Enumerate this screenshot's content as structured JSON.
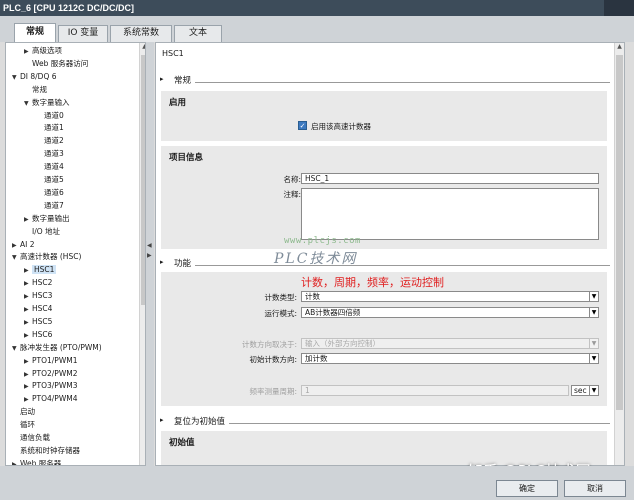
{
  "window": {
    "title": "PLC_6 [CPU 1212C DC/DC/DC]"
  },
  "tabs": [
    {
      "label": "常规",
      "active": true
    },
    {
      "label": "IO 变量",
      "active": false
    },
    {
      "label": "系统常数",
      "active": false
    },
    {
      "label": "文本",
      "active": false
    }
  ],
  "tree": {
    "items": [
      {
        "label": "高级选项",
        "expander": "right"
      },
      {
        "label": "Web 服务器访问",
        "expander": ""
      },
      {
        "label": "DI 8/DQ 6",
        "expander": "down"
      },
      {
        "label": "常规",
        "expander": ""
      },
      {
        "label": "数字量输入",
        "expander": "down"
      },
      {
        "label": "通道0",
        "expander": ""
      },
      {
        "label": "通道1",
        "expander": ""
      },
      {
        "label": "通道2",
        "expander": ""
      },
      {
        "label": "通道3",
        "expander": ""
      },
      {
        "label": "通道4",
        "expander": ""
      },
      {
        "label": "通道5",
        "expander": ""
      },
      {
        "label": "通道6",
        "expander": ""
      },
      {
        "label": "通道7",
        "expander": ""
      },
      {
        "label": "数字量输出",
        "expander": "right"
      },
      {
        "label": "I/O 地址",
        "expander": ""
      },
      {
        "label": "AI 2",
        "expander": "right"
      },
      {
        "label": "高速计数器 (HSC)",
        "expander": "down"
      },
      {
        "label": "HSC1",
        "expander": "right",
        "selected": true
      },
      {
        "label": "HSC2",
        "expander": "right"
      },
      {
        "label": "HSC3",
        "expander": "right"
      },
      {
        "label": "HSC4",
        "expander": "right"
      },
      {
        "label": "HSC5",
        "expander": "right"
      },
      {
        "label": "HSC6",
        "expander": "right"
      },
      {
        "label": "脉冲发生器 (PTO/PWM)",
        "expander": "down"
      },
      {
        "label": "PTO1/PWM1",
        "expander": "right"
      },
      {
        "label": "PTO2/PWM2",
        "expander": "right"
      },
      {
        "label": "PTO3/PWM3",
        "expander": "right"
      },
      {
        "label": "PTO4/PWM4",
        "expander": "right"
      },
      {
        "label": "启动",
        "expander": ""
      },
      {
        "label": "循环",
        "expander": ""
      },
      {
        "label": "通信负载",
        "expander": ""
      },
      {
        "label": "系统和时钟存储器",
        "expander": ""
      },
      {
        "label": "Web 服务器",
        "expander": "right"
      }
    ]
  },
  "main": {
    "header": "HSC1",
    "sections": {
      "general": "常规",
      "function": "功能",
      "reset": "复位为初始值"
    },
    "enable": {
      "title": "启用",
      "checkbox_label": "启用该高速计数器",
      "checked": true
    },
    "project_info": {
      "title": "项目信息",
      "name_label": "名称:",
      "name_value": "HSC_1",
      "comment_label": "注释:",
      "comment_value": ""
    },
    "function": {
      "count_type_label": "计数类型:",
      "count_type_value": "计数",
      "mode_label": "运行模式:",
      "mode_value": "AB计数器四倍频",
      "direction_source_label": "计数方向取决于:",
      "direction_source_value": "输入（外部方向控制）",
      "initial_direction_label": "初始计数方向:",
      "initial_direction_value": "加计数",
      "freq_period_label": "频率测量周期:",
      "freq_period_value": "1",
      "freq_period_unit": "sec"
    },
    "initial_value": {
      "title": "初始值"
    }
  },
  "annotation": "计数，周期，频率，运动控制",
  "watermarks": {
    "url": "www.plcjs.com",
    "logo": "PLC技术网",
    "zhihu": "知乎 @PLC技术网"
  },
  "footer": {
    "ok": "确定",
    "cancel": "取消"
  },
  "colors": {
    "titlebar": "#3d4c5a",
    "annotation": "#e02020",
    "selection": "#cfe3f5"
  }
}
